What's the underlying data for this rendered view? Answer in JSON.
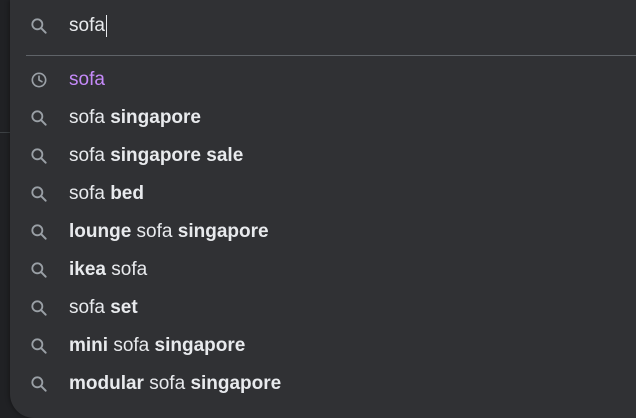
{
  "search": {
    "query": "sofa"
  },
  "colors": {
    "background": "#202124",
    "dropdown": "#303134",
    "text": "#e8eaed",
    "icon": "#9aa0a6",
    "history_text": "#c58af9",
    "separator": "#5f6368"
  },
  "suggestions": [
    {
      "icon": "history-icon",
      "history": true,
      "parts": [
        {
          "text": "sofa",
          "bold": false
        }
      ]
    },
    {
      "icon": "search-icon",
      "history": false,
      "parts": [
        {
          "text": "sofa ",
          "bold": false
        },
        {
          "text": "singapore",
          "bold": true
        }
      ]
    },
    {
      "icon": "search-icon",
      "history": false,
      "parts": [
        {
          "text": "sofa ",
          "bold": false
        },
        {
          "text": "singapore sale",
          "bold": true
        }
      ]
    },
    {
      "icon": "search-icon",
      "history": false,
      "parts": [
        {
          "text": "sofa ",
          "bold": false
        },
        {
          "text": "bed",
          "bold": true
        }
      ]
    },
    {
      "icon": "search-icon",
      "history": false,
      "parts": [
        {
          "text": "lounge",
          "bold": true
        },
        {
          "text": " sofa ",
          "bold": false
        },
        {
          "text": "singapore",
          "bold": true
        }
      ]
    },
    {
      "icon": "search-icon",
      "history": false,
      "parts": [
        {
          "text": "ikea",
          "bold": true
        },
        {
          "text": " sofa",
          "bold": false
        }
      ]
    },
    {
      "icon": "search-icon",
      "history": false,
      "parts": [
        {
          "text": "sofa ",
          "bold": false
        },
        {
          "text": "set",
          "bold": true
        }
      ]
    },
    {
      "icon": "search-icon",
      "history": false,
      "parts": [
        {
          "text": "mini",
          "bold": true
        },
        {
          "text": " sofa ",
          "bold": false
        },
        {
          "text": "singapore",
          "bold": true
        }
      ]
    },
    {
      "icon": "search-icon",
      "history": false,
      "parts": [
        {
          "text": "modular",
          "bold": true
        },
        {
          "text": " sofa ",
          "bold": false
        },
        {
          "text": "singapore",
          "bold": true
        }
      ]
    }
  ]
}
